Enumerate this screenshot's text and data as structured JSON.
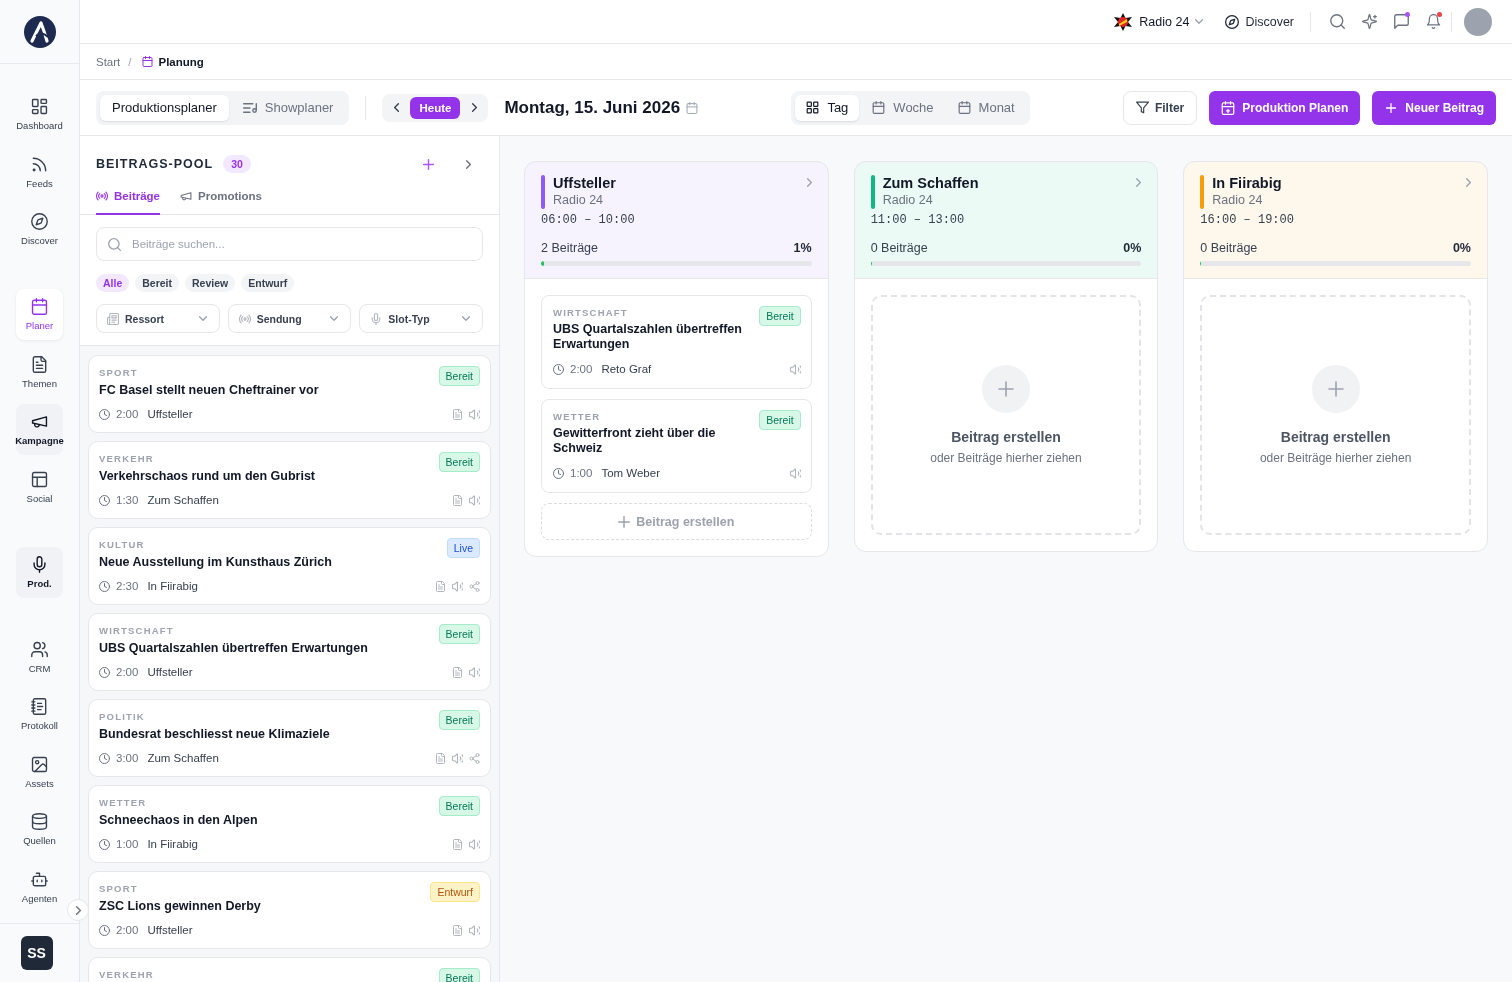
{
  "sidebar": {
    "groups": [
      {
        "items": [
          {
            "label": "Dashboard",
            "selected": false,
            "highlighted": false
          },
          {
            "label": "Feeds",
            "selected": false,
            "highlighted": false
          },
          {
            "label": "Discover",
            "selected": false,
            "highlighted": false
          }
        ]
      },
      {
        "items": [
          {
            "label": "Planer",
            "selected": true,
            "highlighted": false
          },
          {
            "label": "Themen",
            "selected": false,
            "highlighted": false
          },
          {
            "label": "Kampagne",
            "selected": false,
            "highlighted": true
          },
          {
            "label": "Social",
            "selected": false,
            "highlighted": false
          }
        ]
      },
      {
        "items": [
          {
            "label": "Prod.",
            "selected": false,
            "highlighted": true
          }
        ]
      },
      {
        "items": [
          {
            "label": "CRM",
            "selected": false,
            "highlighted": false
          },
          {
            "label": "Protokoll",
            "selected": false,
            "highlighted": false
          },
          {
            "label": "Assets",
            "selected": false,
            "highlighted": false
          },
          {
            "label": "Quellen",
            "selected": false,
            "highlighted": false
          },
          {
            "label": "Agenten",
            "selected": false,
            "highlighted": false
          }
        ]
      }
    ],
    "avatar": "SS"
  },
  "header": {
    "station": "Radio 24",
    "discover": "Discover",
    "messages_unread": true,
    "notifications_unread": true
  },
  "breadcrumb": {
    "separator": "/",
    "items": [
      {
        "label": "Start",
        "current": false
      },
      {
        "label": "Planung",
        "current": true
      }
    ]
  },
  "toolbar": {
    "planners": [
      {
        "label": "Produktionsplaner",
        "selected": true
      },
      {
        "label": "Showplaner",
        "selected": false
      }
    ],
    "today": "Heute",
    "date": "Montag, 15. Juni 2026",
    "views": [
      {
        "label": "Tag",
        "selected": true
      },
      {
        "label": "Woche",
        "selected": false
      },
      {
        "label": "Monat",
        "selected": false
      }
    ],
    "filter": "Filter",
    "actions": [
      "Produktion Planen",
      "Neuer Beitrag"
    ]
  },
  "pool": {
    "title": "BEITRAGS-POOL",
    "count": "30",
    "tabs": [
      {
        "label": "Beiträge",
        "selected": true
      },
      {
        "label": "Promotions",
        "selected": false
      }
    ],
    "search": {
      "placeholder": "Beiträge suchen..."
    },
    "status_filters": [
      {
        "label": "Alle",
        "selected": true
      },
      {
        "label": "Bereit",
        "selected": false
      },
      {
        "label": "Review",
        "selected": false
      },
      {
        "label": "Entwurf",
        "selected": false
      }
    ],
    "dropdowns": [
      "Ressort",
      "Sendung",
      "Slot-Typ"
    ],
    "items": [
      {
        "category": "SPORT",
        "title": "FC Basel stellt neuen Cheftrainer vor",
        "duration": "2:00",
        "slot": "Uffsteller",
        "status": {
          "label": "Bereit",
          "kind": "ready"
        },
        "script": true,
        "audio": true,
        "social": false
      },
      {
        "category": "VERKEHR",
        "title": "Verkehrschaos rund um den Gubrist",
        "duration": "1:30",
        "slot": "Zum Schaffen",
        "status": {
          "label": "Bereit",
          "kind": "ready"
        },
        "script": true,
        "audio": true,
        "social": false
      },
      {
        "category": "KULTUR",
        "title": "Neue Ausstellung im Kunsthaus Zürich",
        "duration": "2:30",
        "slot": "In Fiirabig",
        "status": {
          "label": "Live",
          "kind": "live"
        },
        "script": true,
        "audio": true,
        "social": true
      },
      {
        "category": "WIRTSCHAFT",
        "title": "UBS Quartalszahlen übertreffen Erwartungen",
        "duration": "2:00",
        "slot": "Uffsteller",
        "status": {
          "label": "Bereit",
          "kind": "ready"
        },
        "script": true,
        "audio": true,
        "social": false
      },
      {
        "category": "POLITIK",
        "title": "Bundesrat beschliesst neue Klimaziele",
        "duration": "3:00",
        "slot": "Zum Schaffen",
        "status": {
          "label": "Bereit",
          "kind": "ready"
        },
        "script": true,
        "audio": true,
        "social": true
      },
      {
        "category": "WETTER",
        "title": "Schneechaos in den Alpen",
        "duration": "1:00",
        "slot": "In Fiirabig",
        "status": {
          "label": "Bereit",
          "kind": "ready"
        },
        "script": true,
        "audio": true,
        "social": false
      },
      {
        "category": "SPORT",
        "title": "ZSC Lions gewinnen Derby",
        "duration": "2:00",
        "slot": "Uffsteller",
        "status": {
          "label": "Entwurf",
          "kind": "draft"
        },
        "script": true,
        "audio": true,
        "social": false
      },
      {
        "category": "VERKEHR",
        "status": {
          "label": "Bereit",
          "kind": "ready"
        }
      }
    ]
  },
  "slots": [
    {
      "title": "Uffsteller",
      "station": "Radio 24",
      "time": "06:00 – 10:00",
      "count": "2 Beiträge",
      "percent": "1%",
      "level": 0.01,
      "color": "#8b5cf6",
      "items": [
        {
          "category": "WIRTSCHAFT",
          "title": "UBS Quartalszahlen übertreffen Erwartungen",
          "duration": "2:00",
          "author": "Reto Graf",
          "status": {
            "label": "Bereit",
            "kind": "ready"
          },
          "audio": true
        },
        {
          "category": "WETTER",
          "title": "Gewitterfront zieht über die Schweiz",
          "duration": "1:00",
          "author": "Tom Weber",
          "status": {
            "label": "Bereit",
            "kind": "ready"
          },
          "audio": true
        }
      ],
      "add_label": "Beitrag erstellen"
    },
    {
      "title": "Zum Schaffen",
      "station": "Radio 24",
      "time": "11:00 – 13:00",
      "count": "0 Beiträge",
      "percent": "0%",
      "level": 0,
      "color": "#10b981",
      "dropzone": {
        "title": "Beitrag erstellen",
        "hint": "oder Beiträge hierher ziehen"
      }
    },
    {
      "title": "In Fiirabig",
      "station": "Radio 24",
      "time": "16:00 – 19:00",
      "count": "0 Beiträge",
      "percent": "0%",
      "level": 0,
      "color": "#f59e0b",
      "dropzone": {
        "title": "Beitrag erstellen",
        "hint": "oder Beiträge hierher ziehen"
      }
    }
  ]
}
